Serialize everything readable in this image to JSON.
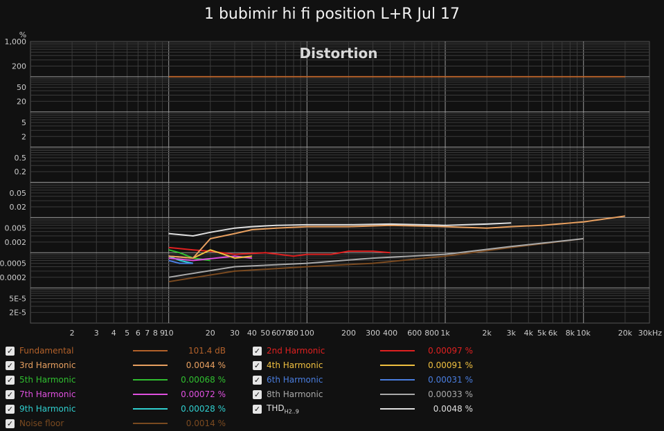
{
  "chart_data": {
    "type": "line",
    "title": "1 bubimir hi fi position L+R Jul 17",
    "annotation": "Distortion",
    "y_unit": "%",
    "x_scale": "log",
    "y_scale": "log",
    "xlim": [
      1,
      30000
    ],
    "ylim": [
      1e-05,
      1000
    ],
    "x_ticks": [
      {
        "v": 2,
        "label": "2"
      },
      {
        "v": 3,
        "label": "3"
      },
      {
        "v": 4,
        "label": "4"
      },
      {
        "v": 5,
        "label": "5"
      },
      {
        "v": 6,
        "label": "6"
      },
      {
        "v": 7,
        "label": "7"
      },
      {
        "v": 8,
        "label": "8"
      },
      {
        "v": 9,
        "label": "9"
      },
      {
        "v": 10,
        "label": "10"
      },
      {
        "v": 20,
        "label": "20"
      },
      {
        "v": 30,
        "label": "30"
      },
      {
        "v": 40,
        "label": "40"
      },
      {
        "v": 50,
        "label": "50"
      },
      {
        "v": 60,
        "label": "60"
      },
      {
        "v": 70,
        "label": "70"
      },
      {
        "v": 80,
        "label": "80"
      },
      {
        "v": 100,
        "label": "100"
      },
      {
        "v": 200,
        "label": "200"
      },
      {
        "v": 300,
        "label": "300"
      },
      {
        "v": 400,
        "label": "400"
      },
      {
        "v": 600,
        "label": "600"
      },
      {
        "v": 800,
        "label": "800"
      },
      {
        "v": 1000,
        "label": "1k"
      },
      {
        "v": 2000,
        "label": "2k"
      },
      {
        "v": 3000,
        "label": "3k"
      },
      {
        "v": 4000,
        "label": "4k"
      },
      {
        "v": 5000,
        "label": "5k"
      },
      {
        "v": 6000,
        "label": "6k"
      },
      {
        "v": 8000,
        "label": "8k"
      },
      {
        "v": 10000,
        "label": "10k"
      },
      {
        "v": 20000,
        "label": "20k"
      },
      {
        "v": 30000,
        "label": "30kHz"
      }
    ],
    "y_ticks": [
      {
        "v": 1000,
        "label": "1,000"
      },
      {
        "v": 200,
        "label": "200"
      },
      {
        "v": 50,
        "label": "50"
      },
      {
        "v": 20,
        "label": "20"
      },
      {
        "v": 5,
        "label": "5"
      },
      {
        "v": 2,
        "label": "2"
      },
      {
        "v": 0.5,
        "label": "0.5"
      },
      {
        "v": 0.2,
        "label": "0.2"
      },
      {
        "v": 0.05,
        "label": "0.05"
      },
      {
        "v": 0.02,
        "label": "0.02"
      },
      {
        "v": 0.005,
        "label": "0.005"
      },
      {
        "v": 0.002,
        "label": "0.002"
      },
      {
        "v": 0.0005,
        "label": "0.0005"
      },
      {
        "v": 0.0002,
        "label": "0.0002"
      },
      {
        "v": 5e-05,
        "label": "5E-5"
      },
      {
        "v": 2e-05,
        "label": "2E-5"
      }
    ],
    "series": [
      {
        "name": "Fundamental",
        "color": "#b3612a",
        "value_label": "101.4 dB",
        "x": [
          10,
          100,
          1000,
          10000,
          20000
        ],
        "y": [
          100,
          100,
          100,
          100,
          100
        ]
      },
      {
        "name": "2nd Harmonic",
        "color": "#e02020",
        "value_label": "0.00097 %",
        "x": [
          10,
          15,
          20,
          30,
          50,
          80,
          100,
          150,
          200,
          300,
          400
        ],
        "y": [
          0.0014,
          0.0012,
          0.0011,
          0.0009,
          0.001,
          0.0008,
          0.0009,
          0.0009,
          0.0011,
          0.0011,
          0.001
        ]
      },
      {
        "name": "3rd Harmonic",
        "color": "#e8a060",
        "value_label": "0.0044 %",
        "x": [
          10,
          15,
          20,
          30,
          40,
          60,
          100,
          200,
          400,
          1000,
          2000,
          3000,
          5000,
          10000,
          20000
        ],
        "y": [
          0.0008,
          0.0007,
          0.0025,
          0.0035,
          0.0045,
          0.005,
          0.0055,
          0.0055,
          0.006,
          0.0055,
          0.005,
          0.0055,
          0.006,
          0.0075,
          0.011
        ]
      },
      {
        "name": "4th Harmonic",
        "color": "#f0c040",
        "value_label": "0.00091 %",
        "x": [
          10,
          15,
          20,
          25,
          30,
          40
        ],
        "y": [
          0.0008,
          0.0007,
          0.0012,
          0.0009,
          0.0007,
          0.0008
        ]
      },
      {
        "name": "5th Harmonic",
        "color": "#30c030",
        "value_label": "0.00068 %",
        "x": [
          10,
          12,
          15,
          20
        ],
        "y": [
          0.0012,
          0.001,
          0.0007,
          0.0006
        ]
      },
      {
        "name": "6th Harmonic",
        "color": "#4a7ee0",
        "value_label": "0.00031 %",
        "x": [
          10,
          12,
          15
        ],
        "y": [
          0.0006,
          0.0005,
          0.0005
        ]
      },
      {
        "name": "7th Harmonic",
        "color": "#e050e0",
        "value_label": "0.00072 %",
        "x": [
          10,
          15,
          30,
          40
        ],
        "y": [
          0.0007,
          0.0006,
          0.0008,
          0.0007
        ]
      },
      {
        "name": "8th Harmonic",
        "color": "#aaaaaa",
        "value_label": "0.00033 %",
        "x": [
          10,
          30,
          100,
          300,
          1000,
          3000,
          10000
        ],
        "y": [
          0.0002,
          0.0004,
          0.0005,
          0.0007,
          0.0009,
          0.0015,
          0.0025
        ]
      },
      {
        "name": "9th Harmonic",
        "color": "#30d0d0",
        "value_label": "0.00028 %",
        "x": [
          10,
          12,
          15
        ],
        "y": [
          0.0008,
          0.0006,
          0.0005
        ]
      },
      {
        "name": "THD",
        "name_sub": "H2..9",
        "color": "#e0e0e0",
        "value_label": "0.0048 %",
        "x": [
          10,
          15,
          20,
          30,
          40,
          60,
          100,
          200,
          400,
          1000,
          2000,
          3000
        ],
        "y": [
          0.0035,
          0.003,
          0.0038,
          0.005,
          0.0055,
          0.006,
          0.0062,
          0.0062,
          0.0065,
          0.006,
          0.0065,
          0.007
        ]
      },
      {
        "name": "Noise floor",
        "color": "#7a4a20",
        "value_label": "0.0014 %",
        "x": [
          10,
          30,
          100,
          300,
          1000,
          3000,
          10000
        ],
        "y": [
          0.00015,
          0.0003,
          0.0004,
          0.0005,
          0.0008,
          0.0014,
          0.0025
        ]
      }
    ]
  }
}
